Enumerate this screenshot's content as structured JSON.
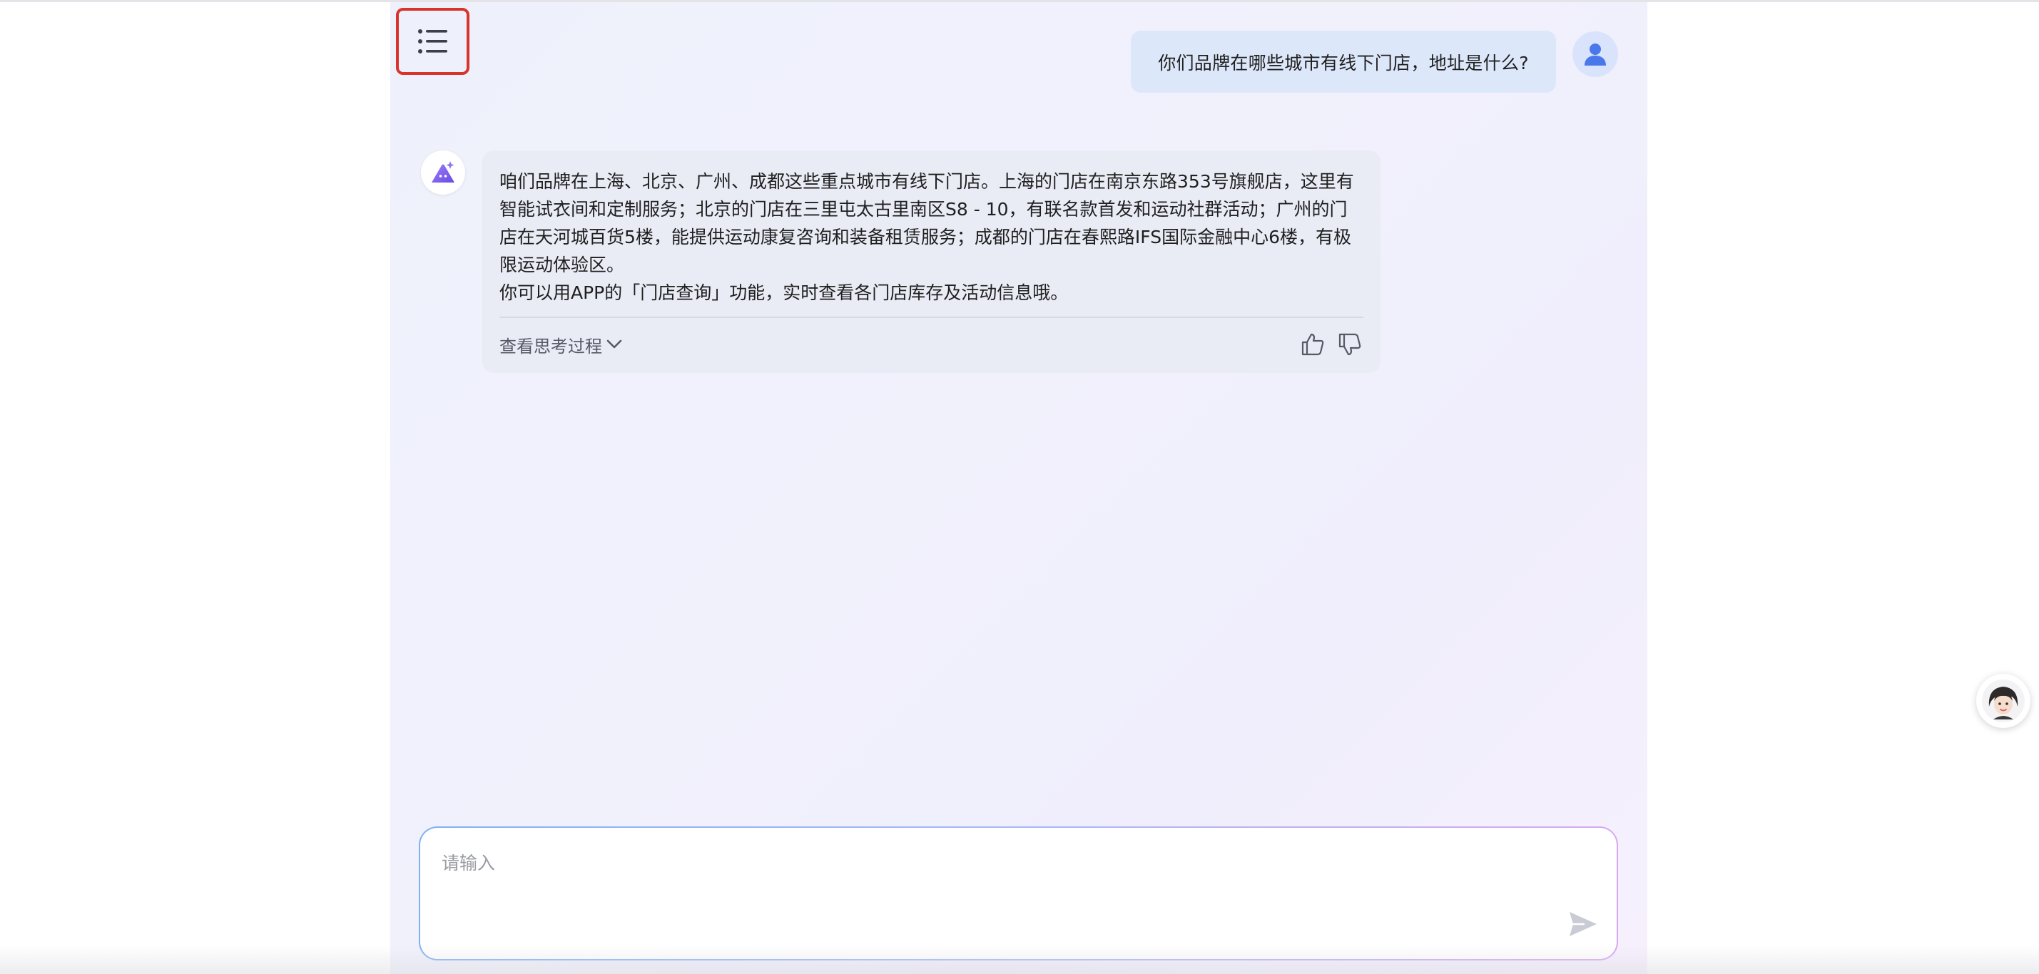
{
  "menu": {
    "icon": "list-menu-icon"
  },
  "user_message": {
    "text": "你们品牌在哪些城市有线下门店，地址是什么?",
    "avatar_icon": "user-avatar-icon"
  },
  "bot_message": {
    "avatar_icon": "bot-logo-icon",
    "paragraph1": "咱们品牌在上海、北京、广州、成都这些重点城市有线下门店。上海的门店在南京东路353号旗舰店，这里有智能试衣间和定制服务；北京的门店在三里屯太古里南区S8 - 10，有联名款首发和运动社群活动；广州的门店在天河城百货5楼，能提供运动康复咨询和装备租赁服务；成都的门店在春熙路IFS国际金融中心6楼，有极限运动体验区。",
    "paragraph2": "你可以用APP的「门店查询」功能，实时查看各门店库存及活动信息哦。",
    "think_toggle_label": "查看思考过程",
    "like_icon": "thumbs-up-icon",
    "dislike_icon": "thumbs-down-icon"
  },
  "input": {
    "placeholder": "请输入",
    "value": "",
    "send_icon": "send-icon"
  },
  "floating_assistant": {
    "icon": "assistant-avatar-icon"
  },
  "colors": {
    "menu_highlight_border": "#d9342b",
    "user_bubble": "#dde7fa",
    "bot_bubble": "#e9ebf5",
    "accent_purple": "#7b5cf0"
  }
}
